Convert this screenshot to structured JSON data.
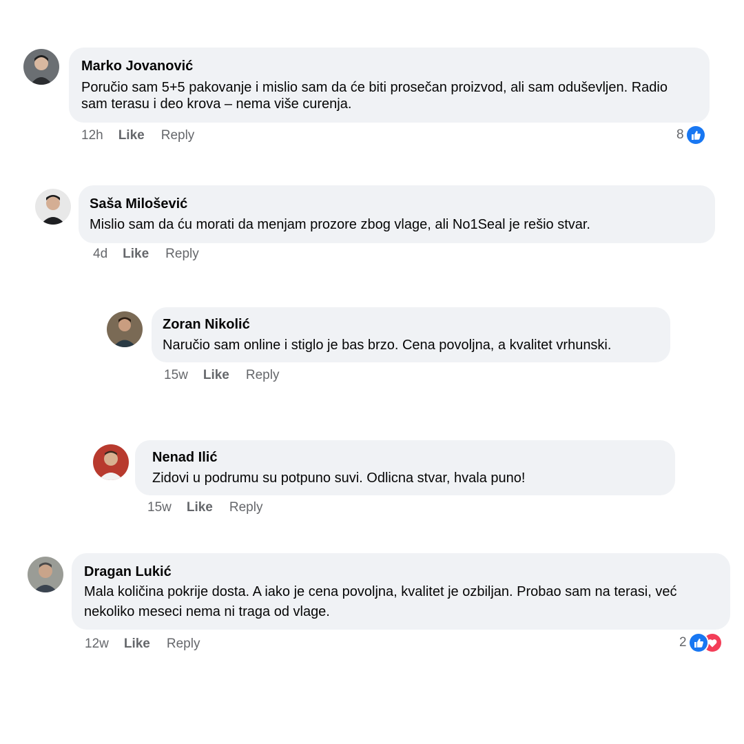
{
  "comments": [
    {
      "author": "Marko Jovanović",
      "text": "Poručio sam 5+5 pakovanje i mislio sam da će biti prosečan proizvod, ali sam oduševljen. Radio sam terasu i deo krova – nema više curenja.",
      "time": "12h",
      "like": "Like",
      "reply": "Reply",
      "reactions": {
        "count": "8",
        "icons": [
          "like-icon"
        ]
      }
    },
    {
      "author": "Saša Milošević",
      "text": "Mislio sam da ću morati da menjam prozore zbog vlage, ali No1Seal je rešio stvar.",
      "time": "4d",
      "like": "Like",
      "reply": "Reply"
    },
    {
      "author": "Zoran Nikolić",
      "text": "Naručio sam online i stiglo je bas brzo. Cena povoljna, a kvalitet vrhunski.",
      "time": "15w",
      "like": "Like",
      "reply": "Reply"
    },
    {
      "author": "Nenad Ilić",
      "text": "Zidovi u podrumu su potpuno suvi. Odlicna stvar, hvala puno!",
      "time": "15w",
      "like": "Like",
      "reply": "Reply"
    },
    {
      "author": "Dragan Lukić",
      "text": "Mala količina pokrije dosta. A iako je cena povoljna, kvalitet je ozbiljan. Probao sam na terasi, već nekoliko meseci nema ni traga od vlage.",
      "time": "12w",
      "like": "Like",
      "reply": "Reply",
      "reactions": {
        "count": "2",
        "icons": [
          "like-icon",
          "love-icon"
        ]
      }
    }
  ],
  "colors": {
    "bubble": "#f0f2f5",
    "meta_text": "#65676b",
    "like_blue": "#1877f2",
    "love_red": "#f33e58"
  }
}
